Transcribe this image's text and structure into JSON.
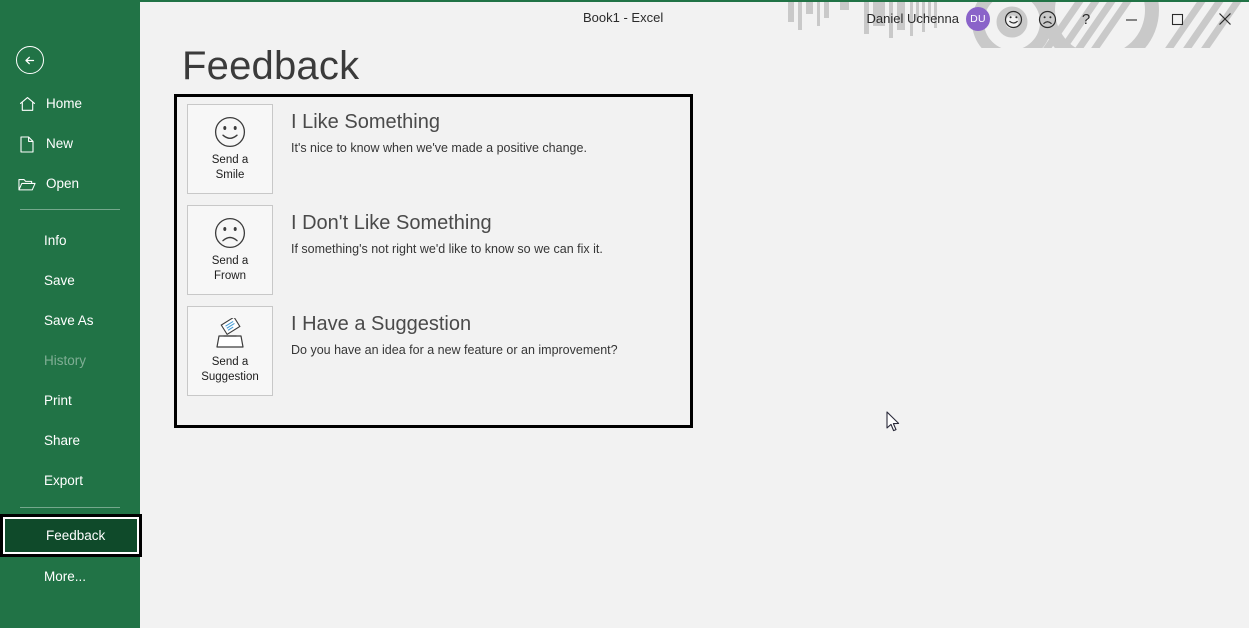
{
  "window": {
    "document_title": "Book1  -  Excel",
    "user_name": "Daniel Uchenna",
    "avatar_initials": "DU",
    "help_label": "?",
    "minimize_label": "Minimize",
    "restore_label": "Restore Down",
    "close_label": "Close",
    "send_smile_label": "Send a Smile",
    "send_frown_label": "Send a Frown",
    "accent_color": "#217346",
    "avatar_color": "#8a63c9"
  },
  "sidebar": {
    "back_label": "Back",
    "icon_items": [
      {
        "label": "Home",
        "icon": "home-icon"
      },
      {
        "label": "New",
        "icon": "new-document-icon"
      },
      {
        "label": "Open",
        "icon": "open-folder-icon"
      }
    ],
    "text_items": [
      {
        "label": "Info",
        "disabled": false
      },
      {
        "label": "Save",
        "disabled": false
      },
      {
        "label": "Save As",
        "disabled": false
      },
      {
        "label": "History",
        "disabled": true
      },
      {
        "label": "Print",
        "disabled": false
      },
      {
        "label": "Share",
        "disabled": false
      },
      {
        "label": "Export",
        "disabled": false
      }
    ],
    "selected_item": "Feedback",
    "more_label": "More..."
  },
  "main": {
    "page_title": "Feedback",
    "options": [
      {
        "tile_caption": "Send a\nSmile",
        "icon": "smiley-face-icon",
        "heading": "I Like Something",
        "description": "It's nice to know when we've made a positive change."
      },
      {
        "tile_caption": "Send a\nFrown",
        "icon": "frowning-face-icon",
        "heading": "I Don't Like Something",
        "description": "If something's not right we'd like to know so we can fix it."
      },
      {
        "tile_caption": "Send a\nSuggestion",
        "icon": "suggestion-box-icon",
        "heading": "I Have a Suggestion",
        "description": "Do you have an idea for a new feature or an improvement?"
      }
    ]
  }
}
